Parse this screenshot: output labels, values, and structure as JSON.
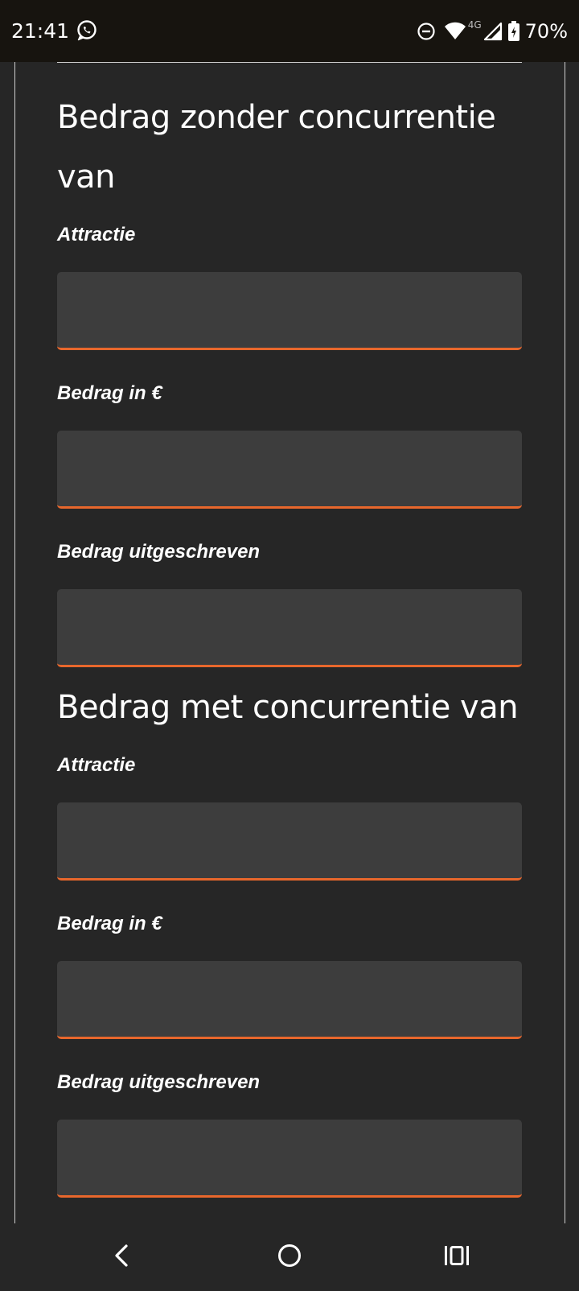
{
  "status_bar": {
    "time": "21:41",
    "network_type": "4G",
    "battery_percent": "70%",
    "icons": [
      "whatsapp-icon",
      "do-not-disturb-icon",
      "wifi-icon",
      "cell-signal-icon",
      "battery-charging-icon"
    ]
  },
  "form": {
    "section_without": {
      "title": "Bedrag zonder concurrentie van",
      "fields": [
        {
          "label": "Attractie",
          "value": ""
        },
        {
          "label": "Bedrag in €",
          "value": ""
        },
        {
          "label": "Bedrag uitgeschreven",
          "value": ""
        }
      ]
    },
    "section_with": {
      "title": "Bedrag met concurrentie van",
      "fields": [
        {
          "label": "Attractie",
          "value": ""
        },
        {
          "label": "Bedrag in €",
          "value": ""
        },
        {
          "label": "Bedrag uitgeschreven",
          "value": ""
        }
      ]
    }
  },
  "nav_bar": {
    "icons": [
      "back-icon",
      "home-icon",
      "recents-icon"
    ]
  },
  "colors": {
    "background": "#262626",
    "status_bar": "#17140f",
    "input_background": "#3d3d3d",
    "accent": "#e8672c",
    "text": "#ffffff"
  }
}
